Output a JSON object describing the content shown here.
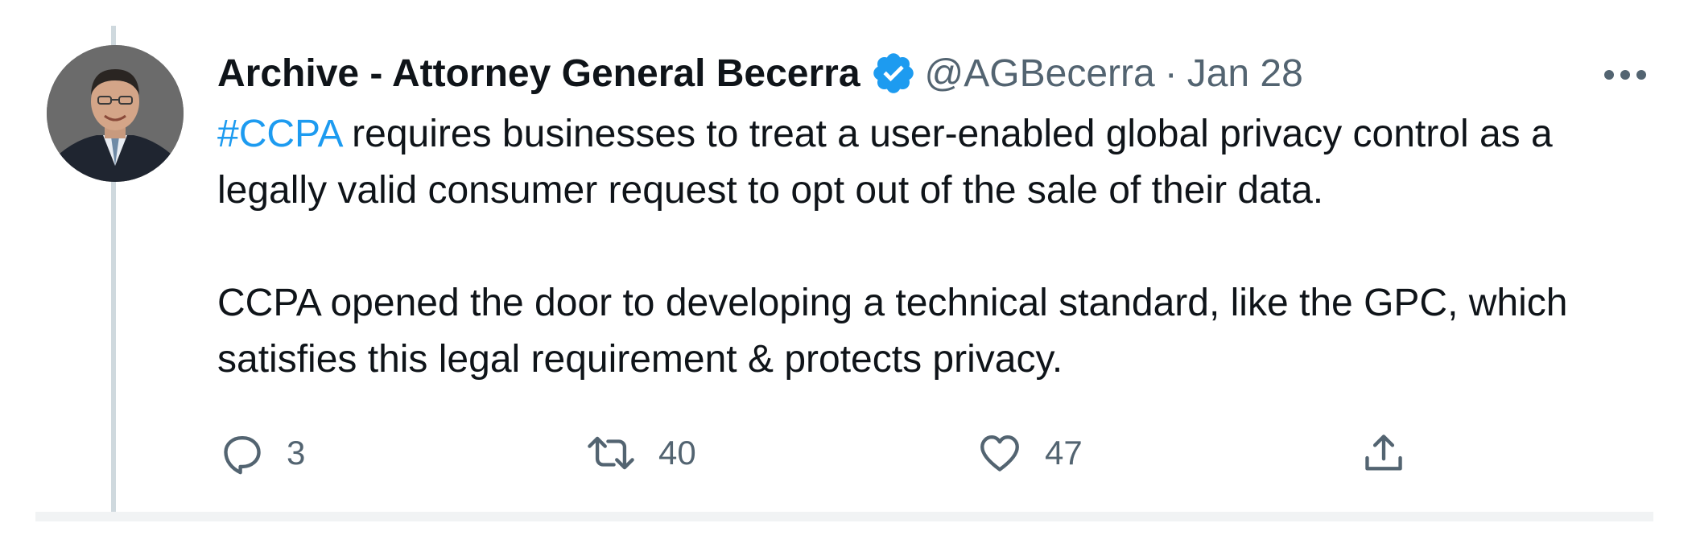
{
  "tweet": {
    "author": {
      "display_name": "Archive - Attorney General Becerra",
      "handle": "@AGBecerra",
      "verified_icon": "verified-badge-icon",
      "avatar": "profile-photo"
    },
    "separator": "·",
    "date": "Jan 28",
    "more_icon": "more-horizontal-icon",
    "body": {
      "hashtag": "#CCPA",
      "line1_rest": " requires businesses to treat a user-enabled global privacy control as a legally valid consumer request to opt out of the sale of their data.",
      "paragraph2": "CCPA opened the door to developing a technical standard, like the GPC, which satisfies this legal requirement & protects privacy."
    },
    "actions": {
      "reply": {
        "icon": "reply-icon",
        "count": "3"
      },
      "retweet": {
        "icon": "retweet-icon",
        "count": "40"
      },
      "like": {
        "icon": "heart-icon",
        "count": "47"
      },
      "share": {
        "icon": "share-icon"
      }
    }
  },
  "colors": {
    "text": "#0f1419",
    "secondary": "#536471",
    "link": "#1d9bf0",
    "thread_line": "#cfd9de"
  }
}
